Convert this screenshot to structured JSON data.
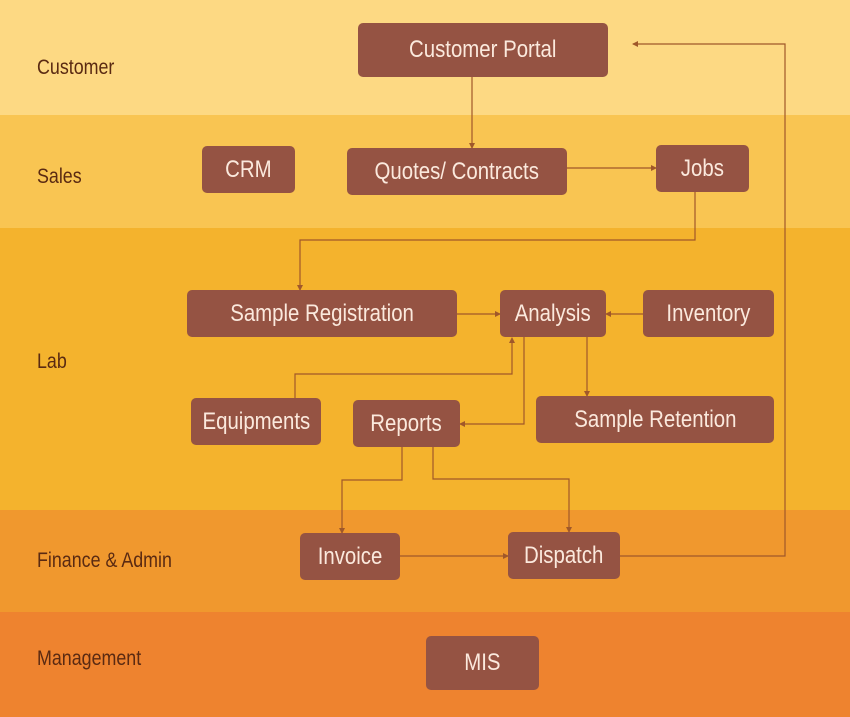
{
  "colors": {
    "customer": "#fdd983",
    "sales": "#f9c552",
    "lab": "#f4b32d",
    "finance": "#f0982e",
    "management": "#ee832f",
    "node": "#955343",
    "node_text": "#fbe9dd",
    "label_text": "#5a2a12",
    "connector": "#a0582a"
  },
  "lanes": [
    {
      "id": "customer",
      "label": "Customer"
    },
    {
      "id": "sales",
      "label": "Sales"
    },
    {
      "id": "lab",
      "label": "Lab"
    },
    {
      "id": "finance",
      "label": "Finance & Admin"
    },
    {
      "id": "management",
      "label": "Management"
    }
  ],
  "nodes": {
    "customer_portal": "Customer Portal",
    "crm": "CRM",
    "quotes": "Quotes/ Contracts",
    "jobs": "Jobs",
    "sample_registration": "Sample Registration",
    "analysis": "Analysis",
    "inventory": "Inventory",
    "equipments": "Equipments",
    "reports": "Reports",
    "sample_retention": "Sample Retention",
    "invoice": "Invoice",
    "dispatch": "Dispatch",
    "mis": "MIS"
  },
  "edges": [
    {
      "from": "Customer Portal",
      "to": "Quotes/ Contracts"
    },
    {
      "from": "Quotes/ Contracts",
      "to": "Jobs"
    },
    {
      "from": "Jobs",
      "to": "Sample Registration"
    },
    {
      "from": "Sample Registration",
      "to": "Analysis"
    },
    {
      "from": "Inventory",
      "to": "Analysis"
    },
    {
      "from": "Equipments",
      "to": "Analysis"
    },
    {
      "from": "Analysis",
      "to": "Reports"
    },
    {
      "from": "Analysis",
      "to": "Sample Retention"
    },
    {
      "from": "Reports",
      "to": "Invoice"
    },
    {
      "from": "Reports",
      "to": "Dispatch"
    },
    {
      "from": "Invoice",
      "to": "Dispatch"
    },
    {
      "from": "Dispatch",
      "to": "Customer Portal"
    }
  ]
}
